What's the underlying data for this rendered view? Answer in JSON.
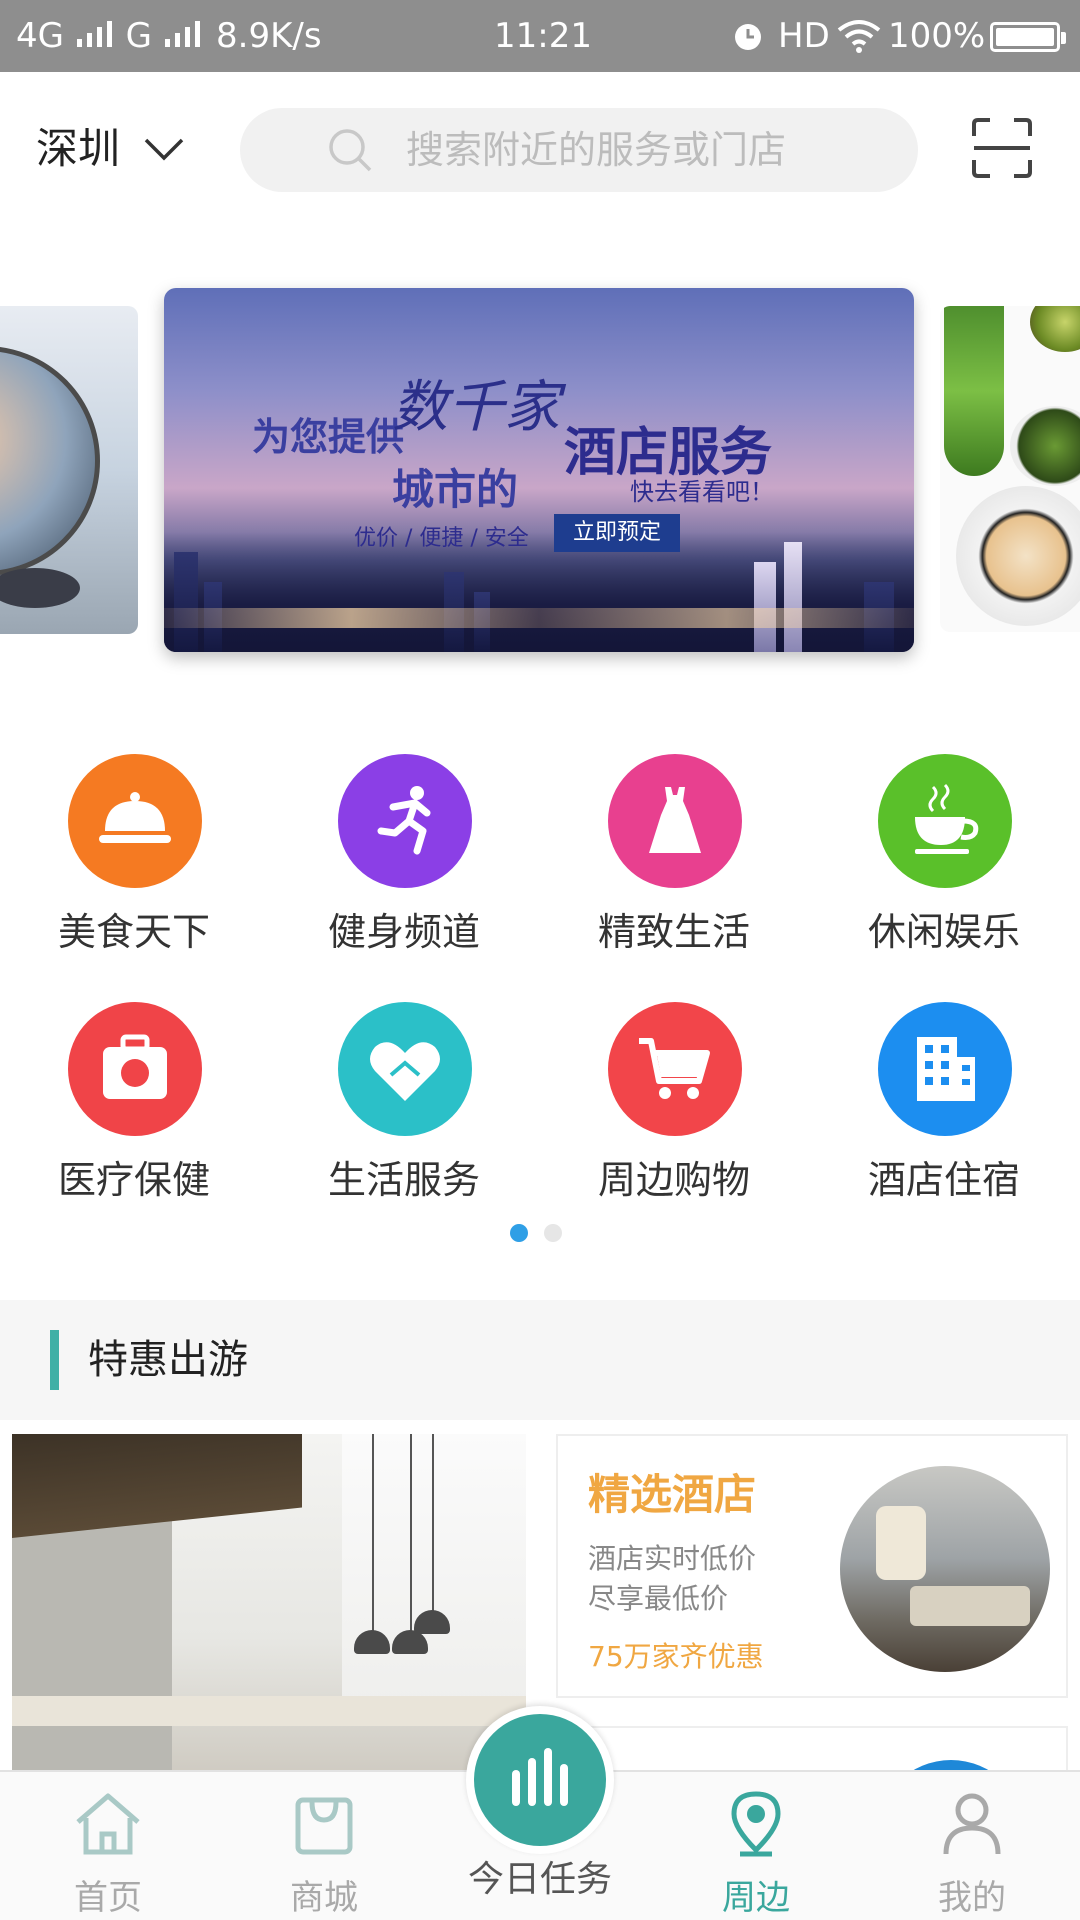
{
  "status_bar": {
    "network": "4G",
    "network2": "G",
    "speed": "8.9K/s",
    "time": "11:21",
    "hd": "HD",
    "battery": "100%"
  },
  "header": {
    "city": "深圳",
    "search_placeholder": "搜索附近的服务或门店"
  },
  "banner": {
    "line1": "为您提供",
    "line2": "数千家",
    "line3": "城市的",
    "line4": "酒店服务",
    "line5": "快去看看吧！",
    "line6": "优价 / 便捷 / 安全",
    "cta": "立即预定"
  },
  "categories": [
    {
      "label": "美食天下",
      "color": "#f57a22",
      "icon": "dish-cover-icon"
    },
    {
      "label": "健身频道",
      "color": "#8b3fe6",
      "icon": "runner-icon"
    },
    {
      "label": "精致生活",
      "color": "#e8408f",
      "icon": "dress-icon"
    },
    {
      "label": "休闲娱乐",
      "color": "#5ac02a",
      "icon": "coffee-cup-icon"
    },
    {
      "label": "医疗保健",
      "color": "#f04448",
      "icon": "medical-kit-icon"
    },
    {
      "label": "生活服务",
      "color": "#2bc0c8",
      "icon": "handshake-heart-icon"
    },
    {
      "label": "周边购物",
      "color": "#f2454a",
      "icon": "shopping-cart-icon"
    },
    {
      "label": "酒店住宿",
      "color": "#1c8ef0",
      "icon": "hotel-building-icon"
    }
  ],
  "pager": {
    "active": 0,
    "count": 2,
    "active_color": "#2f9fe6",
    "inactive_color": "#e6e6e6"
  },
  "section": {
    "title": "特惠出游",
    "accent_color": "#3fb0a6"
  },
  "promo_card": {
    "title": "精选酒店",
    "desc_line1": "酒店实时低价",
    "desc_line2": "尽享最低价",
    "offer": "75万家齐优惠",
    "accent_color": "#f0a742"
  },
  "bottom_nav": {
    "items": [
      {
        "label": "首页",
        "icon": "home-icon",
        "active": false
      },
      {
        "label": "商城",
        "icon": "shopping-bag-icon",
        "active": false
      },
      {
        "label": "今日任务",
        "icon": "bar-chart-icon",
        "active": false
      },
      {
        "label": "周边",
        "icon": "location-pin-icon",
        "active": true
      },
      {
        "label": "我的",
        "icon": "user-icon",
        "active": false
      }
    ],
    "active_color": "#3aa79d",
    "inactive_color": "#a9a9a9"
  }
}
